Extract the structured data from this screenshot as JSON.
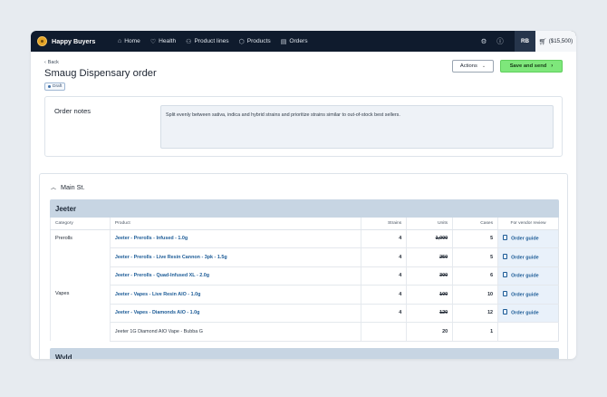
{
  "nav": {
    "brand": "Happy Buyers",
    "items": [
      {
        "label": "Home",
        "icon": "home-icon",
        "glyph": "⌂"
      },
      {
        "label": "Health",
        "icon": "heart-icon",
        "glyph": "♡"
      },
      {
        "label": "Product lines",
        "icon": "group-icon",
        "glyph": "⚇"
      },
      {
        "label": "Products",
        "icon": "box-icon",
        "glyph": "⬡"
      },
      {
        "label": "Orders",
        "icon": "clipboard-icon",
        "glyph": "▤"
      }
    ],
    "avatar": "RB",
    "cart": "($15,500)"
  },
  "header": {
    "back": "Back",
    "title": "Smaug Dispensary order",
    "status": "Draft",
    "actions_label": "Actions",
    "save_label": "Save and send"
  },
  "notes": {
    "label": "Order notes",
    "text": "Split evenly between sativa, indica and hybrid strains and prioritize strains similar to out-of-stock best sellers."
  },
  "location": "Main St.",
  "vendor": {
    "name": "Jeeter",
    "columns": [
      "Category",
      "Product",
      "Strains",
      "Units",
      "Cases",
      "For vendor review"
    ],
    "rows": [
      {
        "category": "Prerolls",
        "product": "Jeeter - Prerolls - Infused - 1.0g",
        "strains": "4",
        "units": "1,000",
        "cases": "5",
        "review": "Order guide"
      },
      {
        "category": "",
        "product": "Jeeter - Prerolls - Live Resin Cannon - 3pk - 1.5g",
        "strains": "4",
        "units": "250",
        "cases": "5",
        "review": "Order guide"
      },
      {
        "category": "",
        "product": "Jeeter - Prerolls - Quad-Infused XL - 2.0g",
        "strains": "4",
        "units": "300",
        "cases": "6",
        "review": "Order guide"
      },
      {
        "category": "Vapes",
        "product": "Jeeter - Vapes - Live Resin AIO - 1.0g",
        "strains": "4",
        "units": "100",
        "cases": "10",
        "review": "Order guide"
      },
      {
        "category": "",
        "product": "Jeeter - Vapes - Diamonds AIO - 1.0g",
        "strains": "4",
        "units": "120",
        "cases": "12",
        "review": "Order guide"
      },
      {
        "category": "",
        "product": "Jeeter 1G Diamond AIO Vape - Bubba G",
        "strains": "",
        "units": "20",
        "cases": "1",
        "review": ""
      }
    ]
  },
  "next_vendor": "Wyld"
}
